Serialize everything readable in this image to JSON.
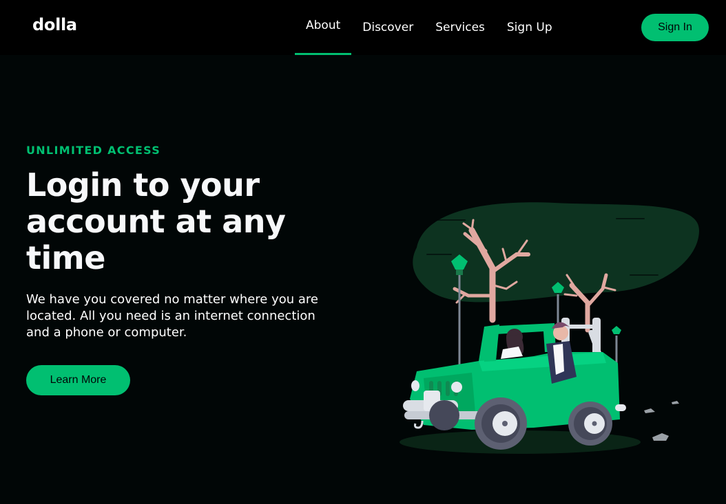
{
  "nav": {
    "logo": "dolla",
    "items": [
      {
        "label": "About",
        "active": true
      },
      {
        "label": "Discover",
        "active": false
      },
      {
        "label": "Services",
        "active": false
      },
      {
        "label": "Sign Up",
        "active": false
      }
    ],
    "signin_label": "Sign In"
  },
  "hero": {
    "topline": "UNLIMITED ACCESS",
    "headline": "Login to your account at any time",
    "subtitle": "We have you covered no matter where you are located. All you need is an internet connection and a phone or computer.",
    "button_label": "Learn More",
    "illustration_icon": "car-illustration"
  },
  "colors": {
    "background": "#010606",
    "navbar": "#000000",
    "accent": "#01bf71",
    "text": "#ffffff"
  }
}
